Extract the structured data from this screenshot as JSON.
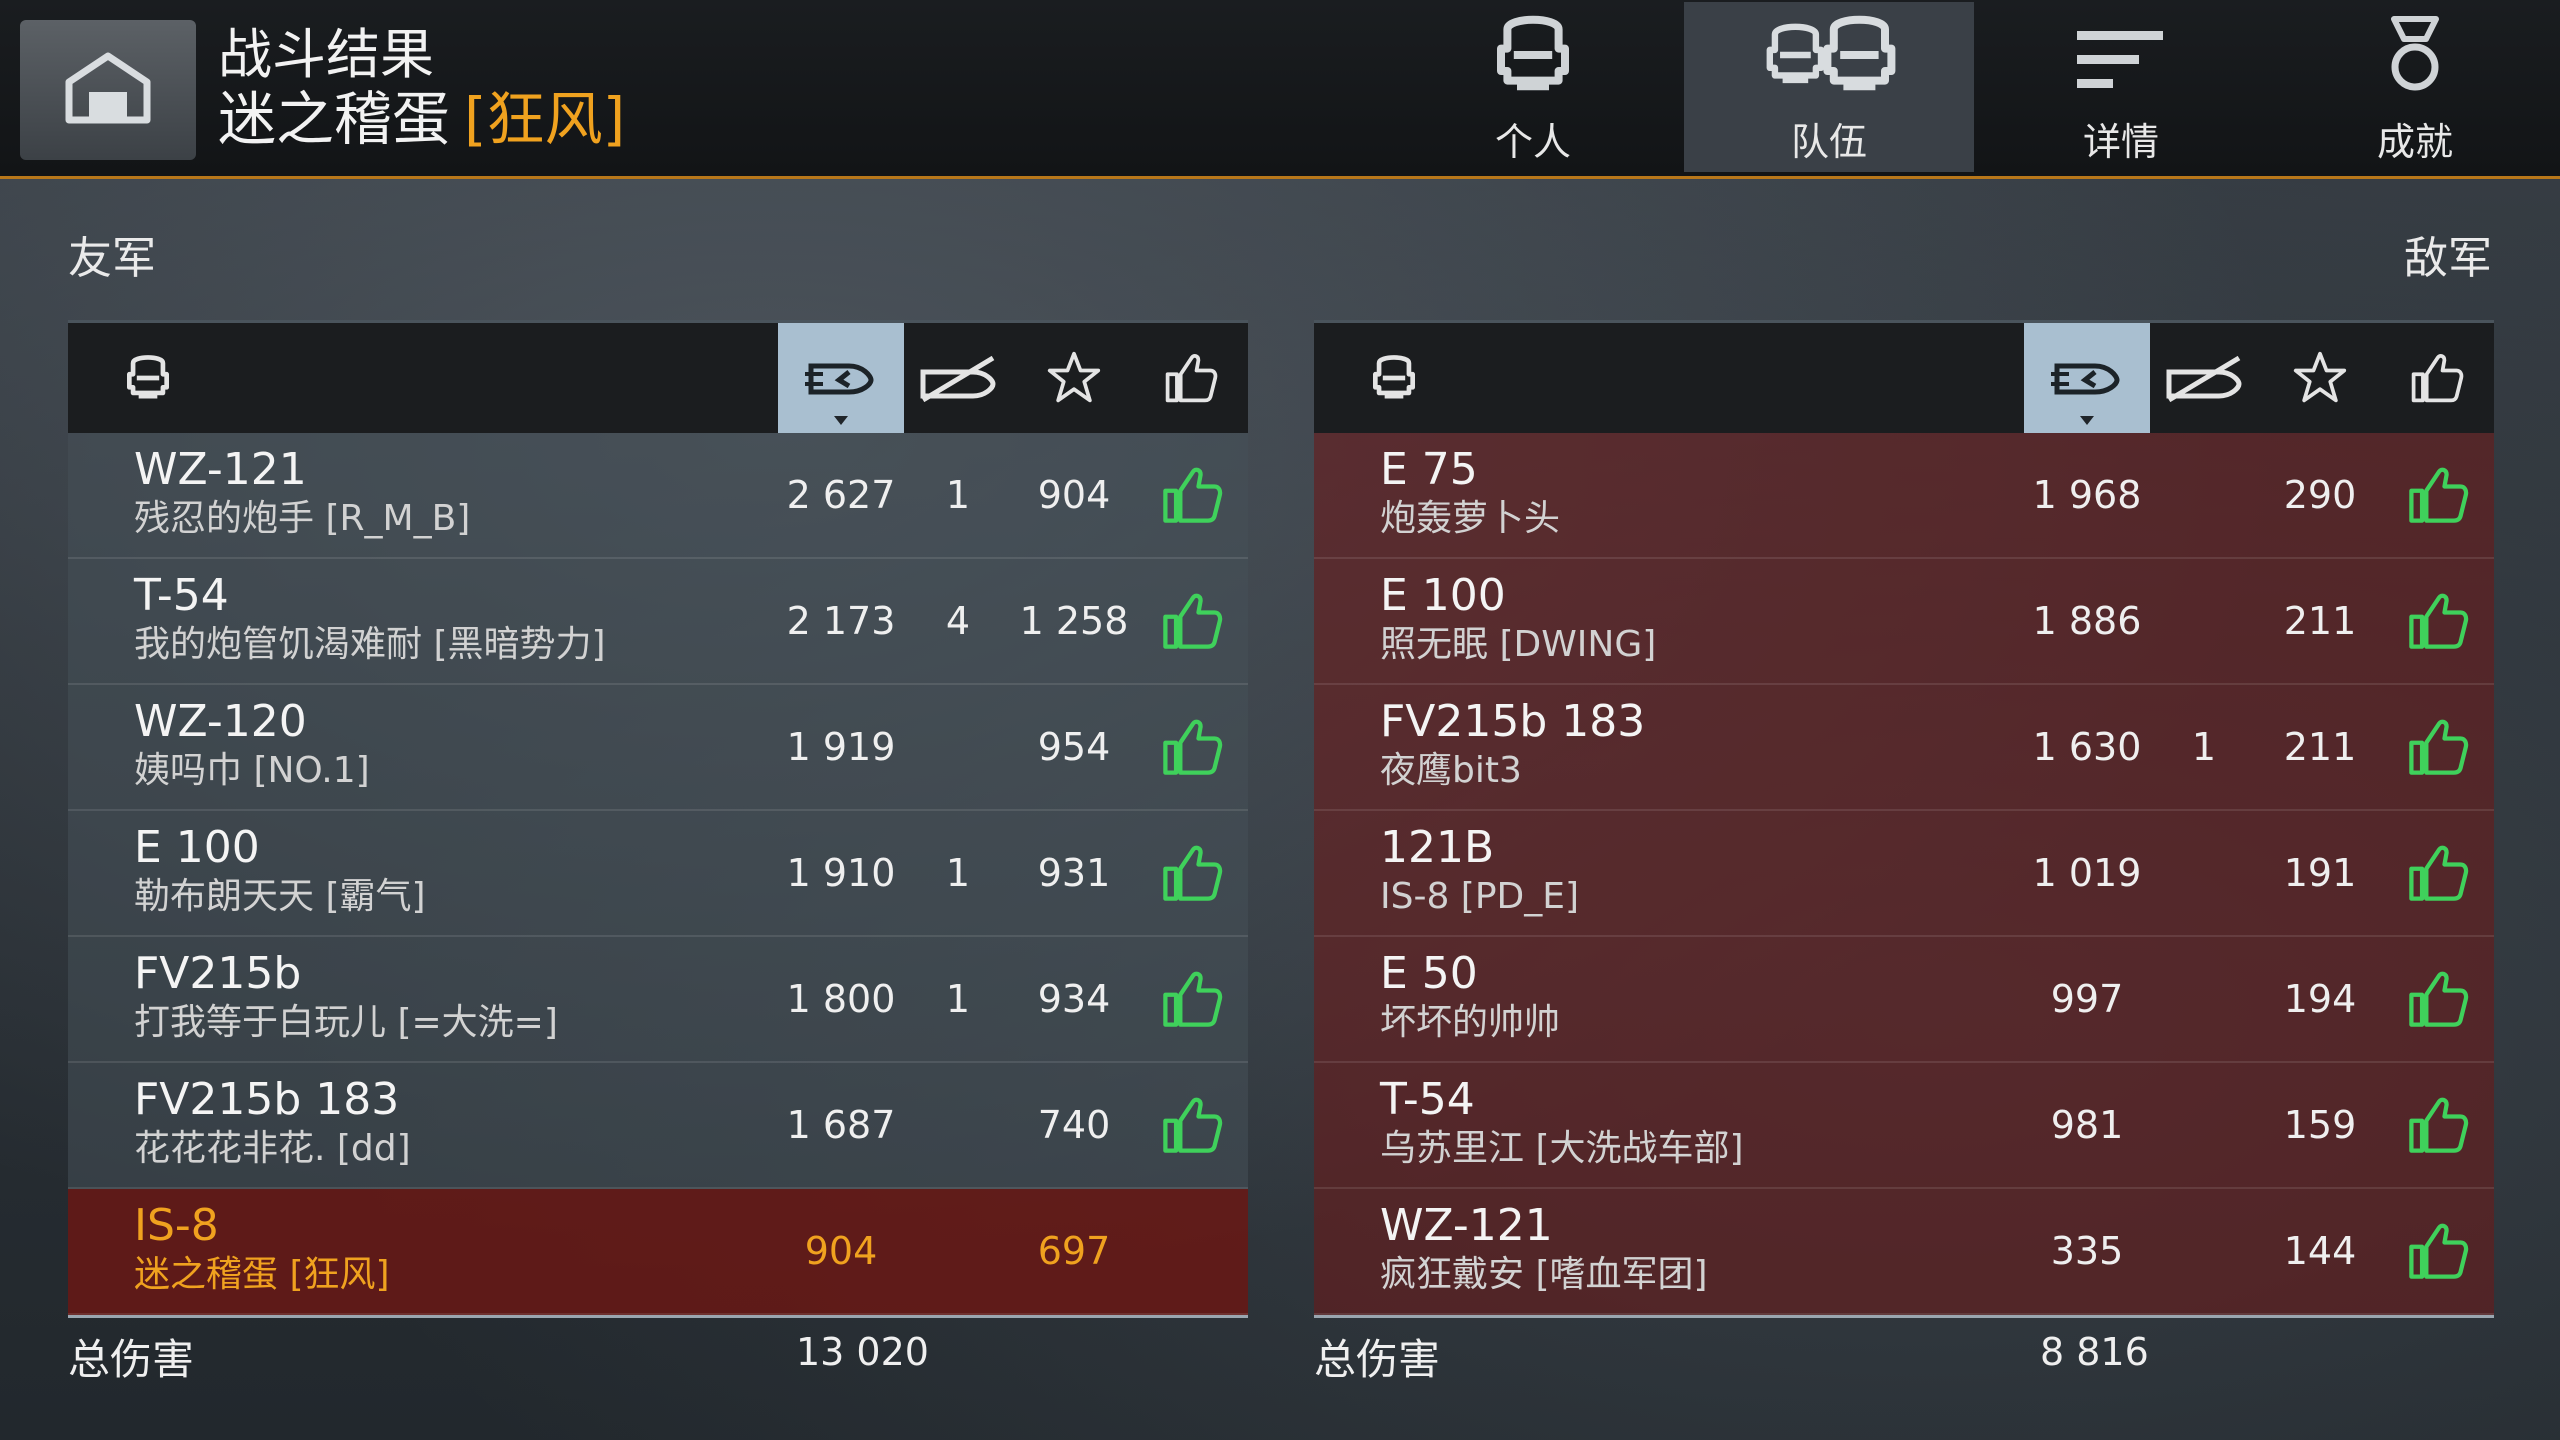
{
  "header": {
    "title": "战斗结果",
    "player_name": "迷之稽蛋",
    "player_clan": "[狂风]",
    "tabs": [
      {
        "label": "个人",
        "icon": "single-tank-helmet-icon",
        "active": false
      },
      {
        "label": "队伍",
        "icon": "team-helmets-icon",
        "active": true
      },
      {
        "label": "详情",
        "icon": "details-lines-icon",
        "active": false
      },
      {
        "label": "成就",
        "icon": "medal-icon",
        "active": false
      }
    ]
  },
  "allies": {
    "title": "友军",
    "total_label": "总伤害",
    "total_damage": "13 020",
    "rows": [
      {
        "tank": "WZ-121",
        "player": "残忍的炮手 [R_M_B]",
        "damage": "2 627",
        "kills": "1",
        "xp": "904",
        "liked": true,
        "self": false
      },
      {
        "tank": "T-54",
        "player": "我的炮管饥渴难耐 [黑暗势力]",
        "damage": "2 173",
        "kills": "4",
        "xp": "1 258",
        "liked": true,
        "self": false
      },
      {
        "tank": "WZ-120",
        "player": "姨吗巾 [NO.1]",
        "damage": "1 919",
        "kills": "",
        "xp": "954",
        "liked": true,
        "self": false
      },
      {
        "tank": "E 100",
        "player": "勒布朗天天 [霸气]",
        "damage": "1 910",
        "kills": "1",
        "xp": "931",
        "liked": true,
        "self": false
      },
      {
        "tank": "FV215b",
        "player": "打我等于白玩儿 [=大洗=]",
        "damage": "1 800",
        "kills": "1",
        "xp": "934",
        "liked": true,
        "self": false
      },
      {
        "tank": "FV215b 183",
        "player": "花花花非花. [dd]",
        "damage": "1 687",
        "kills": "",
        "xp": "740",
        "liked": true,
        "self": false
      },
      {
        "tank": "IS-8",
        "player": "迷之稽蛋 [狂风]",
        "damage": "904",
        "kills": "",
        "xp": "697",
        "liked": false,
        "self": true
      }
    ]
  },
  "enemies": {
    "title": "敌军",
    "total_label": "总伤害",
    "total_damage": "8 816",
    "rows": [
      {
        "tank": "E 75",
        "player": "炮轰萝卜头",
        "damage": "1 968",
        "kills": "",
        "xp": "290",
        "liked": true
      },
      {
        "tank": "E 100",
        "player": "照无眠 [DWING]",
        "damage": "1 886",
        "kills": "",
        "xp": "211",
        "liked": true
      },
      {
        "tank": "FV215b 183",
        "player": "夜鹰bit3",
        "damage": "1 630",
        "kills": "1",
        "xp": "211",
        "liked": true
      },
      {
        "tank": "121B",
        "player": "IS-8 [PD_E]",
        "damage": "1 019",
        "kills": "",
        "xp": "191",
        "liked": true
      },
      {
        "tank": "E 50",
        "player": "坏坏的帅帅",
        "damage": "997",
        "kills": "",
        "xp": "194",
        "liked": true
      },
      {
        "tank": "T-54",
        "player": "乌苏里江 [大洗战车部]",
        "damage": "981",
        "kills": "",
        "xp": "159",
        "liked": true
      },
      {
        "tank": "WZ-121",
        "player": "疯狂戴安 [嗜血军团]",
        "damage": "335",
        "kills": "",
        "xp": "144",
        "liked": true
      }
    ]
  },
  "columns": [
    {
      "icon": "tank-helmet-icon"
    },
    {
      "icon": "damage-shell-icon",
      "sorted": true
    },
    {
      "icon": "kills-crossed-tank-icon"
    },
    {
      "icon": "star-icon"
    },
    {
      "icon": "thumbs-up-icon"
    }
  ],
  "colors": {
    "accent": "#f0a21f",
    "thumb_green": "#3fd15b",
    "sorted_header": "#a9bfd0",
    "enemy_row": "#681c1c"
  }
}
